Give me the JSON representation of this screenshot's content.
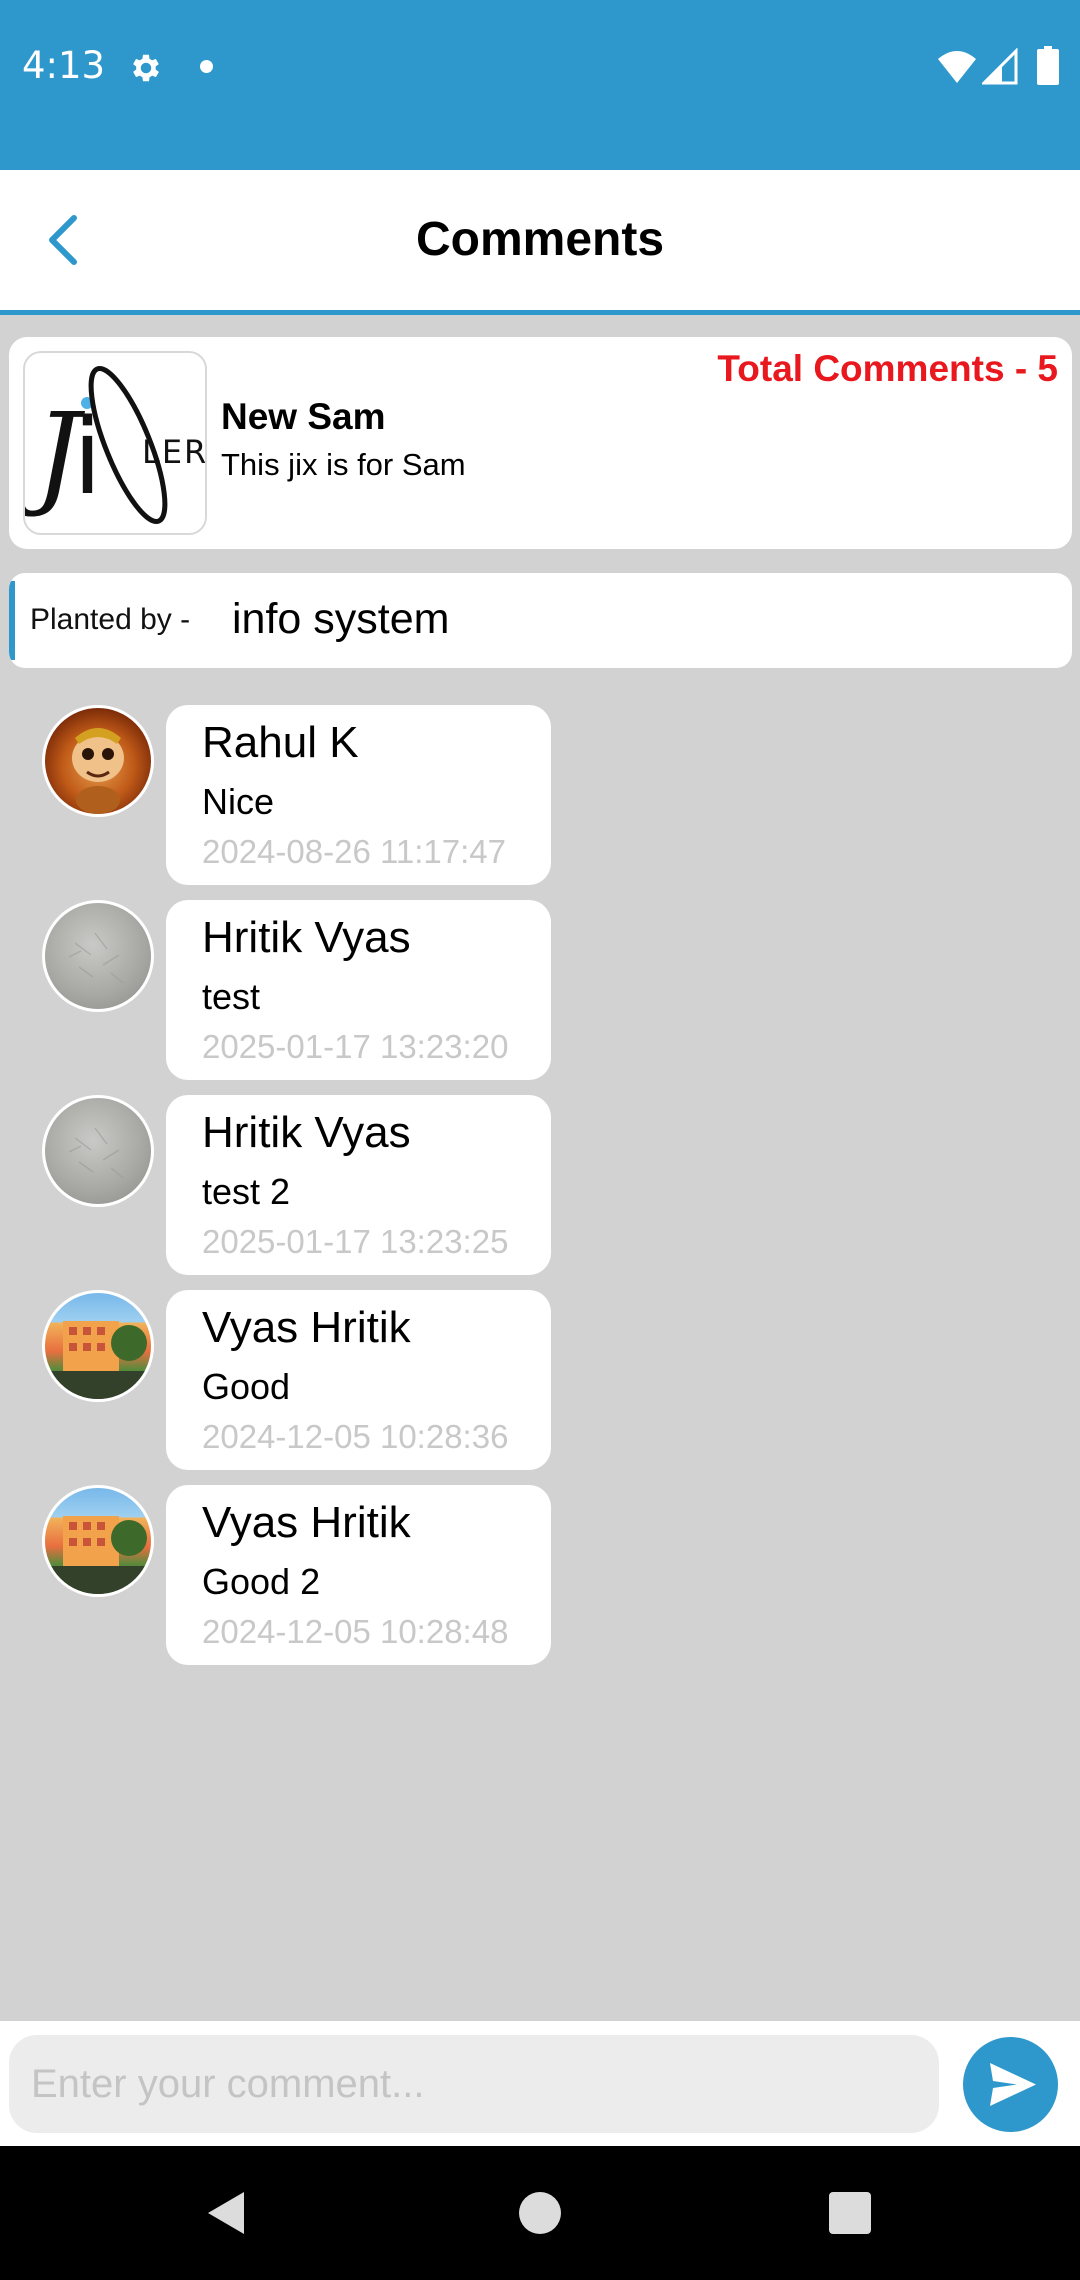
{
  "status_bar": {
    "time": "4:13",
    "icons": [
      "gear-icon",
      "notification-dot-icon",
      "wifi-icon",
      "cell-signal-icon",
      "battery-icon"
    ],
    "background": "#2e98cc"
  },
  "header": {
    "title": "Comments",
    "back_icon": "chevron-left-icon",
    "accent": "#2e98cc"
  },
  "post": {
    "logo_text": "JiXLER",
    "title": "New Sam",
    "description": "This jix is for Sam",
    "total_comments": "Total Comments - 5",
    "total_color": "#e8181e"
  },
  "planted": {
    "label": "Planted by -",
    "name": "info system"
  },
  "comments": [
    {
      "name": "Rahul K",
      "text": "Nice",
      "time": "2024-08-26 11:17:47",
      "avatar": "monkey-avatar"
    },
    {
      "name": "Hritik Vyas",
      "text": "test",
      "time": "2025-01-17 13:23:20",
      "avatar": "default-avatar"
    },
    {
      "name": "Hritik Vyas",
      "text": "test 2",
      "time": "2025-01-17 13:23:25",
      "avatar": "default-avatar"
    },
    {
      "name": "Vyas Hritik",
      "text": "Good",
      "time": "2024-12-05 10:28:36",
      "avatar": "building-avatar"
    },
    {
      "name": "Vyas Hritik",
      "text": "Good 2",
      "time": "2024-12-05 10:28:48",
      "avatar": "building-avatar"
    }
  ],
  "input": {
    "placeholder": "Enter your comment...",
    "value": "",
    "send_icon": "send-icon"
  },
  "nav": {
    "icons": [
      "nav-back-icon",
      "nav-home-icon",
      "nav-recents-icon"
    ]
  }
}
